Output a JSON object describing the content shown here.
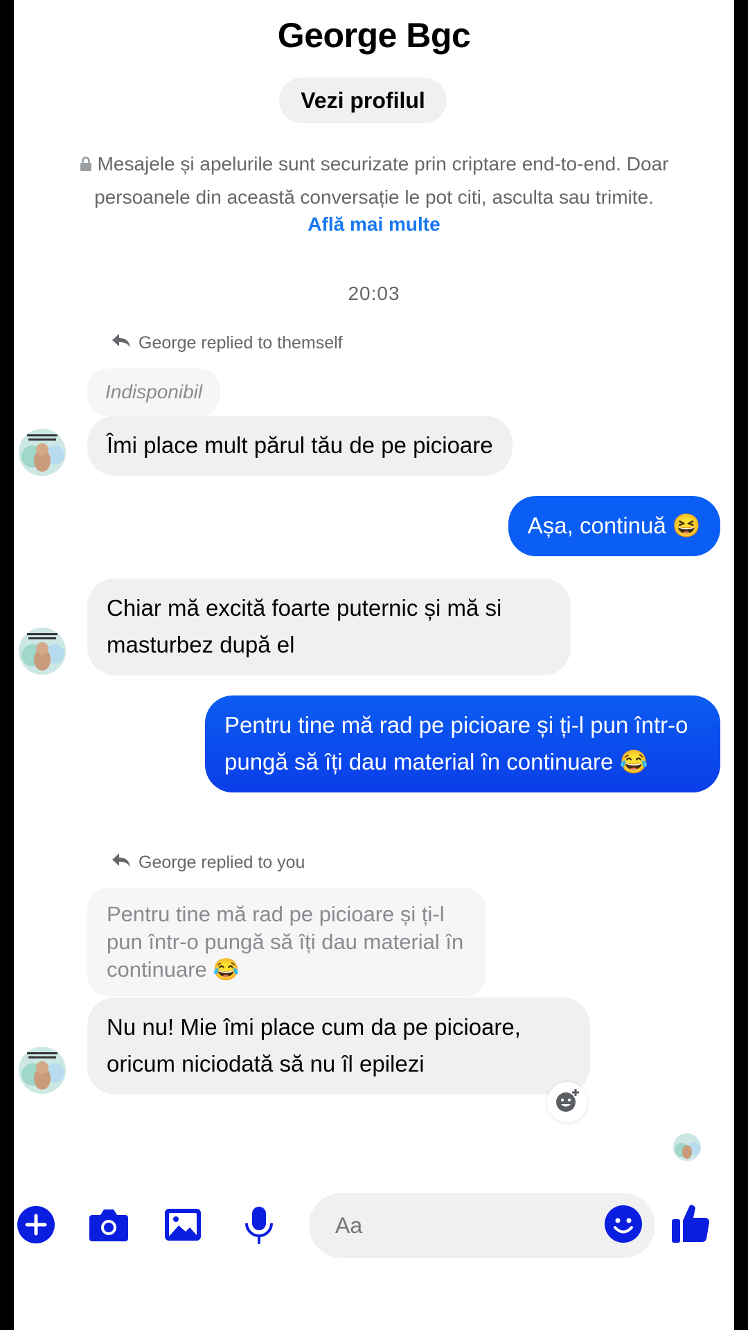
{
  "header": {
    "title": "George Bgc",
    "profile_button": "Vezi profilul"
  },
  "encryption": {
    "text": "Mesajele și apelurile sunt securizate prin criptare end-to-end. Doar persoanele din această conversație le pot citi, asculta sau trimite.",
    "learn_more": "Află mai multe"
  },
  "timestamp": "20:03",
  "messages": {
    "reply1_label": "George replied to themself",
    "reply1_quoted": "Indisponibil",
    "msg1": "Îmi place mult părul tău de pe picioare",
    "msg2": "Așa, continuă 😆",
    "msg3": "Chiar mă excită foarte puternic și mă si masturbez după el",
    "msg4": "Pentru tine mă rad pe picioare și ți-l  pun într-o pungă să îți dau material în continuare 😂",
    "reply2_label": "George replied to you",
    "reply2_quoted": "Pentru tine mă rad pe picioare și ți-l  pun într-o pungă să îți dau material în continuare 😂",
    "msg5": "Nu nu! Mie îmi place cum da pe picioare, oricum niciodată să nu îl epilezi"
  },
  "composer": {
    "placeholder": "Aa",
    "icons": [
      "plus-icon",
      "camera-icon",
      "gallery-icon",
      "microphone-icon",
      "emoji-icon",
      "thumbs-up-icon"
    ]
  },
  "colors": {
    "accent": "#1877f2",
    "outgoing_bubble": "#0a5ef5",
    "composer_icons": "#0a1ee0"
  }
}
